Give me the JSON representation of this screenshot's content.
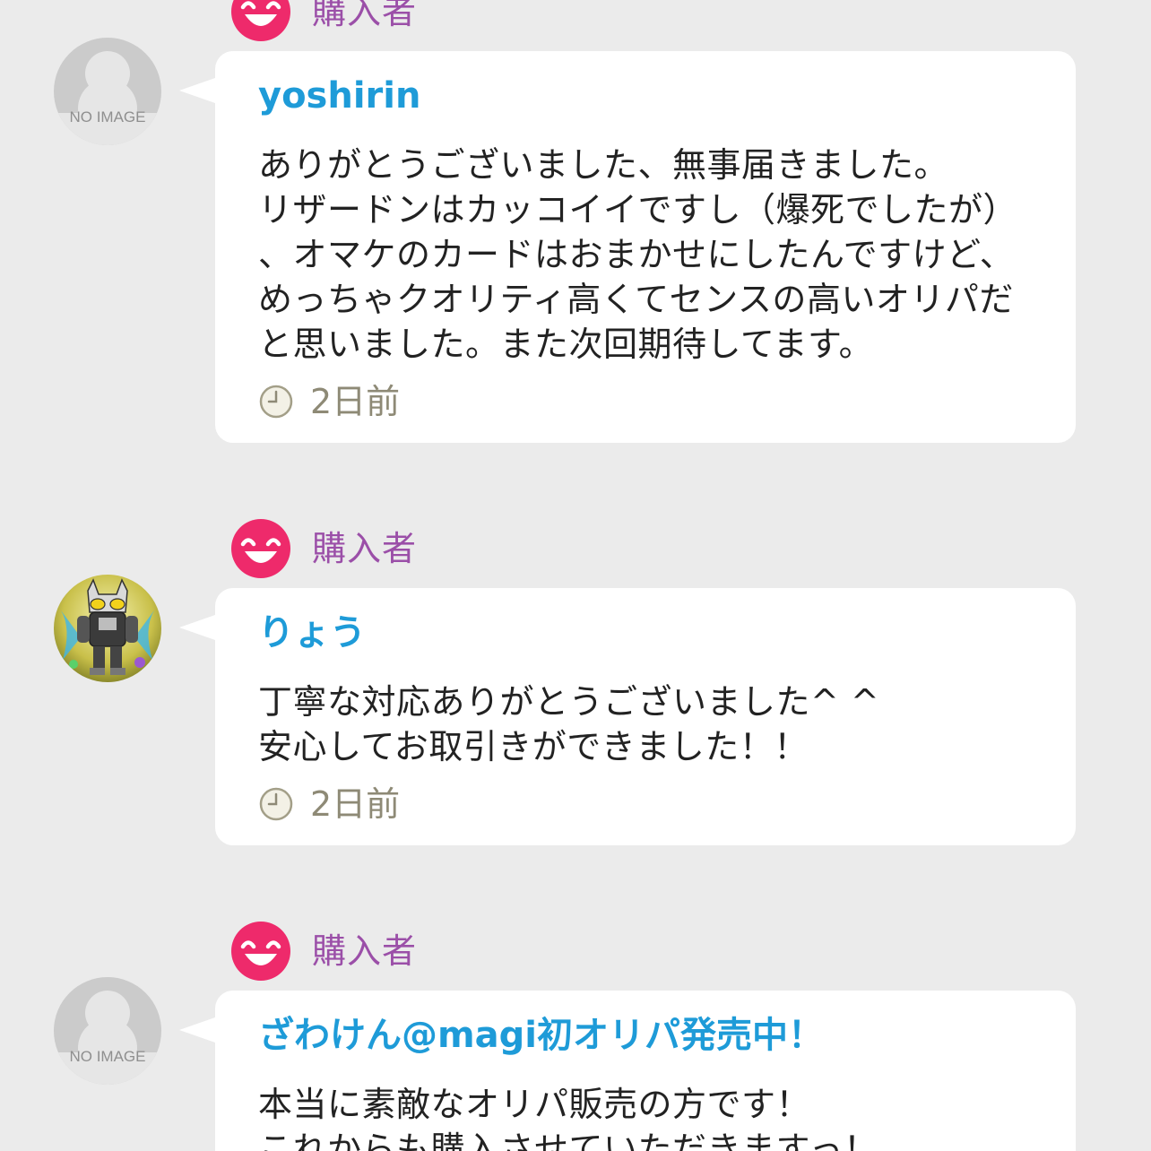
{
  "colors": {
    "background": "#ebebeb",
    "card": "#ffffff",
    "username": "#1e9bd8",
    "badge_label": "#9b4fa8",
    "smile_icon": "#ee2a6b",
    "time_text": "#8e8a76"
  },
  "reviews": [
    {
      "badge": {
        "icon": "smile-rating-icon",
        "label": "購入者"
      },
      "avatar": {
        "type": "no-image",
        "placeholder_text": "NO IMAGE"
      },
      "username": "yoshirin",
      "comment": "ありがとうございました、無事届きました。\nリザードンはカッコイイですし（爆死でしたが）\n、オマケのカードはおまかせにしたんですけど、\nめっちゃクオリティ高くてセンスの高いオリパだ\nと思いました。また次回期待してます。",
      "time": {
        "icon": "clock-icon",
        "label": "2日前"
      }
    },
    {
      "badge": {
        "icon": "smile-rating-icon",
        "label": "購入者"
      },
      "avatar": {
        "type": "image",
        "description_icon": "armored-hero-avatar"
      },
      "username": "りょう",
      "comment": "丁寧な対応ありがとうございました^ ^\n安心してお取引きができました！！",
      "time": {
        "icon": "clock-icon",
        "label": "2日前"
      }
    },
    {
      "badge": {
        "icon": "smile-rating-icon",
        "label": "購入者"
      },
      "avatar": {
        "type": "no-image",
        "placeholder_text": "NO IMAGE"
      },
      "username": "ざわけん@magi初オリパ発売中！",
      "comment": "本当に素敵なオリパ販売の方です！\nこれからも購入させていただきますっ！"
    }
  ]
}
